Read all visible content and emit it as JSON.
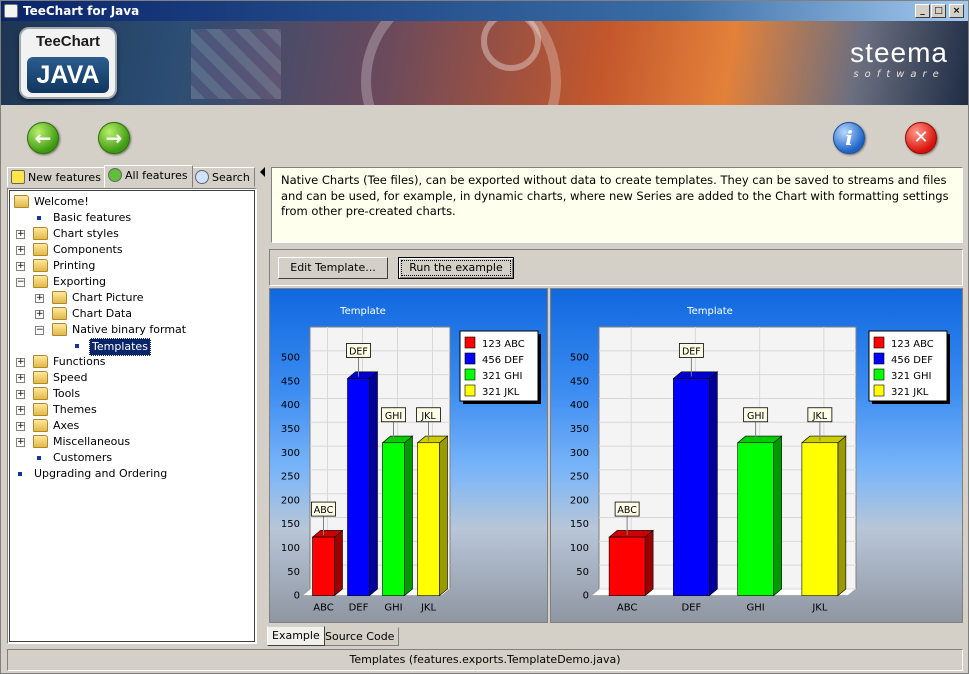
{
  "window": {
    "title": "TeeChart for Java"
  },
  "banner": {
    "tee_logo_top": "TeeChart",
    "tee_logo_bottom": "JAVA",
    "steema_main": "steema",
    "steema_sub": "software"
  },
  "left_tabs": [
    {
      "label": "New features",
      "icon": "lightbulb-icon",
      "active": false
    },
    {
      "label": "All features",
      "icon": "recycle-icon",
      "active": true
    },
    {
      "label": "Search",
      "icon": "magnifier-icon",
      "active": false
    }
  ],
  "tree": [
    {
      "label": "Welcome!",
      "level": 0,
      "kind": "folder-open"
    },
    {
      "label": "Basic features",
      "level": 1,
      "kind": "leaf"
    },
    {
      "label": "Chart styles",
      "level": 1,
      "kind": "folder"
    },
    {
      "label": "Components",
      "level": 1,
      "kind": "folder"
    },
    {
      "label": "Printing",
      "level": 1,
      "kind": "folder"
    },
    {
      "label": "Exporting",
      "level": 1,
      "kind": "folder-open"
    },
    {
      "label": "Chart Picture",
      "level": 2,
      "kind": "folder"
    },
    {
      "label": "Chart Data",
      "level": 2,
      "kind": "folder"
    },
    {
      "label": "Native binary format",
      "level": 2,
      "kind": "folder-open"
    },
    {
      "label": "Templates",
      "level": 3,
      "kind": "leaf",
      "selected": true
    },
    {
      "label": "Functions",
      "level": 1,
      "kind": "folder"
    },
    {
      "label": "Speed",
      "level": 1,
      "kind": "folder"
    },
    {
      "label": "Tools",
      "level": 1,
      "kind": "folder"
    },
    {
      "label": "Themes",
      "level": 1,
      "kind": "folder"
    },
    {
      "label": "Axes",
      "level": 1,
      "kind": "folder"
    },
    {
      "label": "Miscellaneous",
      "level": 1,
      "kind": "folder"
    },
    {
      "label": "Customers",
      "level": 1,
      "kind": "leaf"
    },
    {
      "label": "Upgrading and Ordering",
      "level": 0,
      "kind": "leaf"
    }
  ],
  "description": "Native Charts (Tee files), can be exported without data to create templates. They can be saved to streams and files and can be used, for example, in dynamic charts, where new Series are added to the Chart with formatting settings from other pre-created charts.",
  "buttons": {
    "edit_template": "Edit Template...",
    "run_example": "Run the example"
  },
  "bottom_tabs": [
    {
      "label": "Example",
      "active": true
    },
    {
      "label": "Source Code",
      "active": false
    }
  ],
  "status": "Templates  (features.exports.TemplateDemo.java)",
  "chart_data": [
    {
      "type": "bar",
      "title": "Template",
      "categories": [
        "ABC",
        "DEF",
        "GHI",
        "JKL"
      ],
      "values": [
        123,
        456,
        321,
        321
      ],
      "colors": [
        "#ff0000",
        "#0000ff",
        "#00ff00",
        "#ffff00"
      ],
      "legend": [
        "123 ABC",
        "456 DEF",
        "321 GHI",
        "321 JKL"
      ],
      "legend_position": "top-right",
      "ylim": [
        0,
        550
      ],
      "yticks": [
        0,
        50,
        100,
        150,
        200,
        250,
        300,
        350,
        400,
        450,
        500
      ],
      "grid": true
    },
    {
      "type": "bar",
      "title": "Template",
      "categories": [
        "ABC",
        "DEF",
        "GHI",
        "JKL"
      ],
      "values": [
        123,
        456,
        321,
        321
      ],
      "colors": [
        "#ff0000",
        "#0000ff",
        "#00ff00",
        "#ffff00"
      ],
      "legend": [
        "123 ABC",
        "456 DEF",
        "321 GHI",
        "321 JKL"
      ],
      "legend_position": "top-right",
      "ylim": [
        0,
        550
      ],
      "yticks": [
        0,
        50,
        100,
        150,
        200,
        250,
        300,
        350,
        400,
        450,
        500
      ],
      "grid": true
    }
  ]
}
